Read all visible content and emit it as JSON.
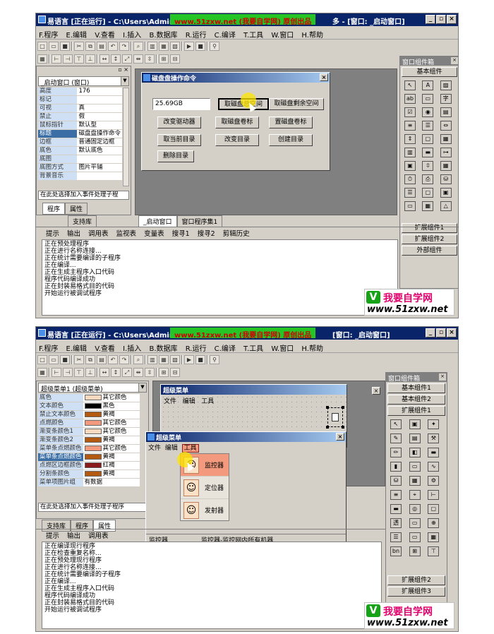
{
  "top": {
    "title_app": "易语言 [正在运行] - C:\\Users\\Admin",
    "title_highlight": "www.51zxw.net (我要自学网) 原创出品",
    "title_after": "多 - [窗口: _启动窗口]",
    "menu": [
      "F.程序",
      "E.编辑",
      "V.查看",
      "I.插入",
      "B.数据库",
      "R.运行",
      "C.编译",
      "T.工具",
      "W.窗口",
      "H.帮助"
    ],
    "prop_header": "_启动窗口 (窗口)",
    "props": [
      {
        "k": "高度",
        "v": "176"
      },
      {
        "k": "标记",
        "v": ""
      },
      {
        "k": "可视",
        "v": "真"
      },
      {
        "k": "禁止",
        "v": "假"
      },
      {
        "k": "鼠标指针",
        "v": "默认型"
      },
      {
        "k": "标题",
        "v": "磁盘盘操作命令",
        "sel": true
      },
      {
        "k": "边框",
        "v": "普通固定边框"
      },
      {
        "k": "底色",
        "v": "默认底色"
      },
      {
        "k": "底图",
        "v": ""
      },
      {
        "k": "底图方式",
        "v": "图片平铺"
      },
      {
        "k": "背景音乐",
        "v": ""
      }
    ],
    "event_select": "在此处选择加入事件处理子程",
    "left_tabs": [
      "程序",
      "属性"
    ],
    "support_tab": "支持库",
    "form_title": "磁盘盘操作命令",
    "textbox": "25.69GB",
    "buttons": [
      "取磁盘总空间",
      "取磁盘剩余空间",
      "改变驱动器",
      "取磁盘卷标",
      "置磁盘卷标",
      "取当前目录",
      "改变目录",
      "创建目录",
      "删除目录"
    ],
    "designer_tabs": [
      "_启动窗口",
      "窗口程序集1"
    ],
    "toolbox_title": "窗口组件箱",
    "toolbox_basic": "基本组件",
    "toolbox_ext1": "扩展组件1",
    "toolbox_ext2": "扩展组件2",
    "toolbox_ext3": "外部组件",
    "output_tabs": [
      "提示",
      "输出",
      "调用表",
      "监视表",
      "变量表",
      "搜寻1",
      "搜寻2",
      "剪辑历史"
    ],
    "output_lines": [
      "正在预处理程序",
      "正在进行名称连接...",
      "正在统计需要编译的子程序",
      "正在编译...",
      "正在生成主程序入口代码",
      "程序代码编译成功",
      "正在封装易格式目的代码",
      "开始运行被调试程序"
    ]
  },
  "bottom": {
    "title_app": "易语言 [正在运行] - C:\\Users\\Admin",
    "title_highlight": "www.51zxw.net (我要自学网) 原创出品",
    "title_after": "[窗口: _启动窗口]",
    "menu": [
      "F.程序",
      "E.编辑",
      "V.查看",
      "I.插入",
      "B.数据库",
      "R.运行",
      "C.编译",
      "T.工具",
      "W.窗口",
      "H.帮助"
    ],
    "prop_header": "超级菜单1 (超级菜单)",
    "props": [
      {
        "k": "底色",
        "v": "其它颜色",
        "c": "#f7d9c0"
      },
      {
        "k": "文本颜色",
        "v": "黑色",
        "c": "#000000"
      },
      {
        "k": "禁止文本颜色",
        "v": "黄褐",
        "c": "#b35a10"
      },
      {
        "k": "点燃颜色",
        "v": "其它颜色",
        "c": "#f39a7e"
      },
      {
        "k": "渐变条颜色1",
        "v": "其它颜色",
        "c": "#f7d9c0"
      },
      {
        "k": "渐变条颜色2",
        "v": "黄褐",
        "c": "#b35a10"
      },
      {
        "k": "菜单条点燃颜色",
        "v": "其它颜色",
        "c": "#f39a7e"
      },
      {
        "k": "菜单条点燃颜色",
        "v": "黄褐",
        "c": "#b35a10",
        "sel": true
      },
      {
        "k": "点燃区边框颜色",
        "v": "红褐",
        "c": "#8b1a1a"
      },
      {
        "k": "分割条颜色",
        "v": "黄褐",
        "c": "#b35a10"
      },
      {
        "k": "菜单项图片组",
        "v": "有数据",
        "c": ""
      }
    ],
    "event_select": "在此处选择加入事件处理子程序",
    "left_tabs": [
      "支持库",
      "程序",
      "属性"
    ],
    "designer_title": "超级菜单",
    "designer_menu": [
      "文件",
      "编辑",
      "工具"
    ],
    "run_title": "超级菜单",
    "run_menu": [
      "文件",
      "编辑",
      "工具"
    ],
    "dropdown": [
      "监控器",
      "定位器",
      "发射器"
    ],
    "status_left": "监控器",
    "status_right": "监控器-监控网内所有机器",
    "toolbox_title": "窗口组件箱",
    "toolbox_tabs": [
      "基本组件1",
      "基本组件2",
      "扩展组件1"
    ],
    "toolbox_ext2": "扩展组件2",
    "toolbox_ext3": "扩展组件3",
    "output_tabs": [
      "提示",
      "输出",
      "调用表"
    ],
    "output_lines": [
      "正在编译现行程序",
      "正在检查重复名称...",
      "正在预处理现行程序",
      "正在进行名称连接...",
      "正在统计需要编译的子程序",
      "正在编译...",
      "正在生成主程序入口代码",
      "程序代码编译成功",
      "正在封装易格式目的代码",
      "开始运行被调试程序"
    ]
  },
  "watermark": {
    "top": "我要自学网",
    "bottom": "www.51zxw.net"
  }
}
